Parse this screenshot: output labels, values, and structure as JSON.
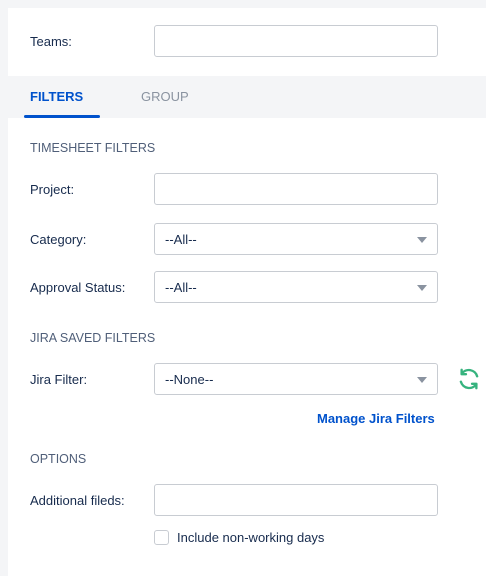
{
  "teams": {
    "label": "Teams:",
    "value": ""
  },
  "tabs": [
    {
      "label": "FILTERS",
      "active": true
    },
    {
      "label": "GROUP",
      "active": false
    }
  ],
  "timesheet_filters": {
    "title": "TIMESHEET FILTERS",
    "project": {
      "label": "Project:",
      "value": ""
    },
    "category": {
      "label": "Category:",
      "value": "--All--"
    },
    "approval_status": {
      "label": "Approval Status:",
      "value": "--All--"
    }
  },
  "jira_saved_filters": {
    "title": "JIRA SAVED FILTERS",
    "jira_filter": {
      "label": "Jira Filter:",
      "value": "--None--"
    },
    "refresh_icon": "refresh-icon",
    "manage_link": "Manage Jira Filters"
  },
  "options": {
    "title": "OPTIONS",
    "additional_fields": {
      "label": "Additional fileds:",
      "value": ""
    },
    "include_non_working_days": {
      "label": "Include non-working days",
      "checked": false
    }
  },
  "colors": {
    "accent": "#0052cc",
    "refresh_green": "#36b37e",
    "tab_bar": "#f4f5f7"
  }
}
